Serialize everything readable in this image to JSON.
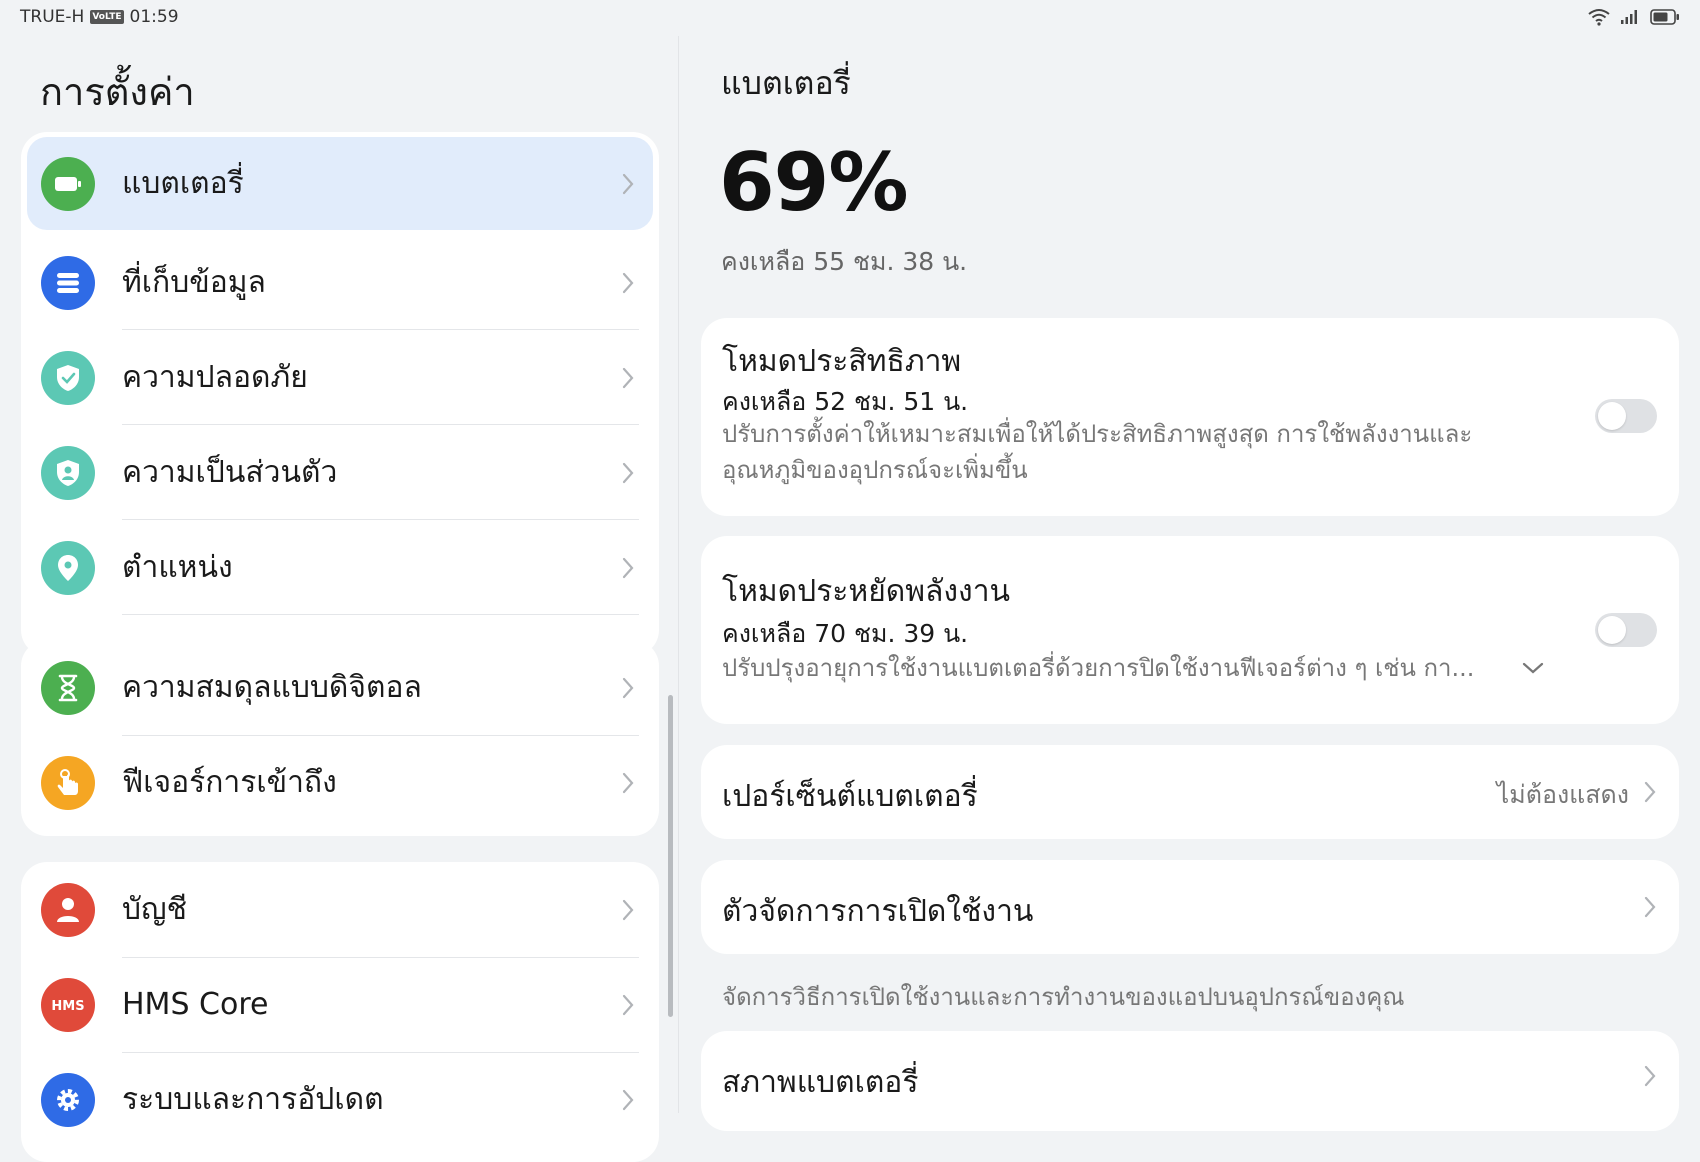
{
  "status_bar": {
    "carrier": "TRUE-H",
    "volte": "VoLTE",
    "time": "01:59"
  },
  "left": {
    "title": "การตั้งค่า",
    "groups": [
      [
        {
          "label": "แบตเตอรี่",
          "icon": "battery-icon",
          "color": "#4caf50",
          "selected": true
        },
        {
          "label": "ที่เก็บข้อมูล",
          "icon": "storage-icon",
          "color": "#2f6be6"
        },
        {
          "label": "ความปลอดภัย",
          "icon": "shield-check-icon",
          "color": "#5cc8b4"
        },
        {
          "label": "ความเป็นส่วนตัว",
          "icon": "privacy-shield-icon",
          "color": "#5cc8b4"
        },
        {
          "label": "ตำแหน่ง",
          "icon": "location-pin-icon",
          "color": "#5cc8b4"
        }
      ],
      [
        {
          "label": "ความสมดุลแบบดิจิตอล",
          "icon": "hourglass-icon",
          "color": "#4caf50"
        },
        {
          "label": "ฟีเจอร์การเข้าถึง",
          "icon": "hand-pointer-icon",
          "color": "#f5a623"
        }
      ],
      [
        {
          "label": "บัญชี",
          "icon": "user-icon",
          "color": "#e04a3a"
        },
        {
          "label": "HMS Core",
          "icon": "hms-core-icon",
          "color": "#e04a3a"
        },
        {
          "label": "ระบบและการอัปเดต",
          "icon": "gear-icon",
          "color": "#2f6be6"
        }
      ]
    ]
  },
  "right": {
    "title": "แบตเตอรี่",
    "percent": "69%",
    "remaining": "คงเหลือ 55 ชม. 38 น.",
    "performance_mode": {
      "title": "โหมดประสิทธิภาพ",
      "remaining": "คงเหลือ 52 ชม. 51 น.",
      "desc": "ปรับการตั้งค่าให้เหมาะสมเพื่อให้ได้ประสิทธิภาพสูงสุด การใช้พลังงานและอุณหภูมิของอุปกรณ์จะเพิ่มขึ้น",
      "enabled": false
    },
    "power_saving_mode": {
      "title": "โหมดประหยัดพลังงาน",
      "remaining": "คงเหลือ 70 ชม. 39 น.",
      "desc": "ปรับปรุงอายุการใช้งานแบตเตอรี่ด้วยการปิดใช้งานฟีเจอร์ต่าง ๆ เช่น กา...",
      "enabled": false
    },
    "battery_percentage": {
      "title": "เปอร์เซ็นต์แบตเตอรี่",
      "value": "ไม่ต้องแสดง"
    },
    "app_launch": {
      "title": "ตัวจัดการการเปิดใช้งาน",
      "hint": "จัดการวิธีการเปิดใช้งานและการทำงานของแอปบนอุปกรณ์ของคุณ"
    },
    "battery_health": {
      "title": "สภาพแบตเตอรี่"
    }
  },
  "colors": {
    "background": "#f1f3f5",
    "selected_item": "#e1ecfb",
    "toggle_off": "#dfe1e4"
  }
}
